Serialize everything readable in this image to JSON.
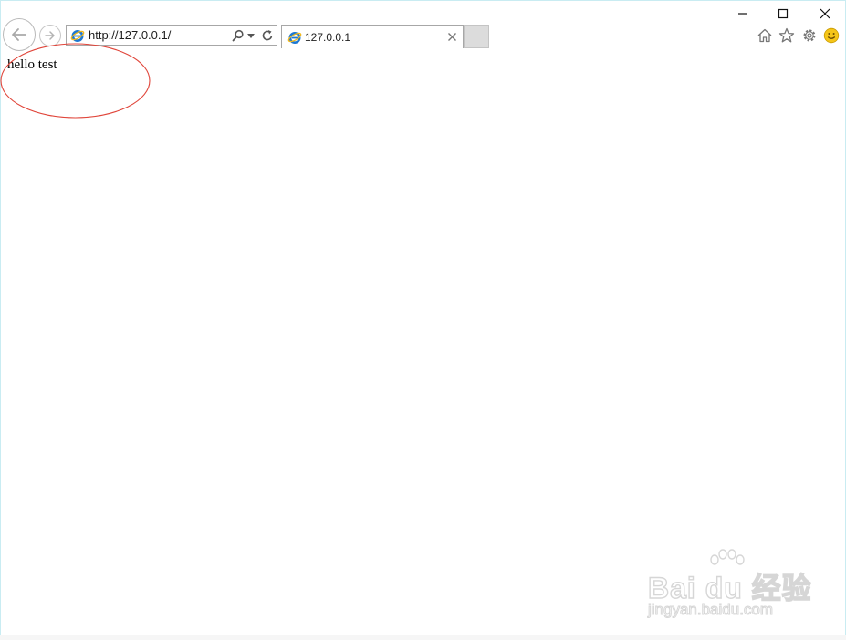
{
  "window": {
    "minimize_label": "",
    "maximize_label": "",
    "close_label": ""
  },
  "toolbar": {
    "address_url": "http://127.0.0.1/",
    "icons": [
      "back-icon",
      "forward-icon",
      "search-icon",
      "dropdown-icon",
      "refresh-icon",
      "home-icon",
      "favorites-icon",
      "settings-icon",
      "feedback-smiley-icon"
    ]
  },
  "tabs": [
    {
      "title": "127.0.0.1"
    }
  ],
  "page": {
    "body_text": "hello test"
  },
  "annotation": {
    "color": "#e0453a"
  },
  "watermark": {
    "brand": "Bai du 经验",
    "sub": "jingyan.baidu.com"
  },
  "colors": {
    "ie_blue": "#1e78d2",
    "ie_ring": "#f2b91c",
    "smiley": "#f5c518"
  }
}
